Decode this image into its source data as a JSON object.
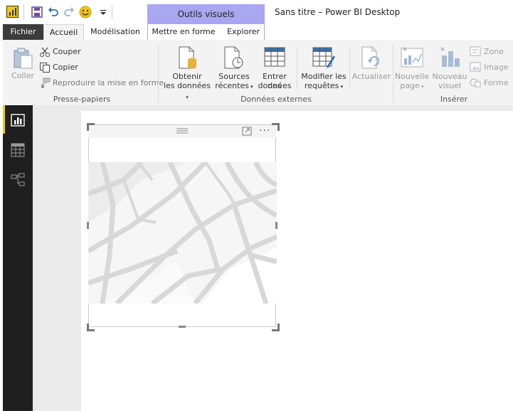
{
  "window": {
    "title": "Sans titre – Power BI Desktop",
    "contextual_tab_group": "Outils visuels"
  },
  "quick_access": {
    "icons": [
      "power-bi-icon",
      "save-icon",
      "undo-icon",
      "redo-icon",
      "smiley-icon",
      "customize-icon"
    ]
  },
  "tabs": {
    "fichier": "Fichier",
    "accueil": "Accueil",
    "modelisation": "Modélisation",
    "mettre_en_forme": "Mettre en forme",
    "explorer": "Explorer"
  },
  "ribbon": {
    "clipboard": {
      "coller": "Coller",
      "couper": "Couper",
      "copier": "Copier",
      "reproduire": "Reproduire la mise en forme",
      "group": "Presse-papiers"
    },
    "external_data": {
      "obtenir_1": "Obtenir",
      "obtenir_2": "les données",
      "sources_1": "Sources",
      "sources_2": "récentes",
      "entrer_1": "Entrer des",
      "entrer_2": "données",
      "modifier_1": "Modifier les",
      "modifier_2": "requêtes",
      "actualiser": "Actualiser",
      "group": "Données externes"
    },
    "insert": {
      "nouvelle_page_1": "Nouvelle",
      "nouvelle_page_2": "page",
      "nouveau_visuel_1": "Nouveau",
      "nouveau_visuel_2": "visuel",
      "zone": "Zone",
      "image": "Image",
      "forme": "Forme",
      "group": "Insérer"
    }
  },
  "left_nav": {
    "items": [
      "report-view-icon",
      "data-view-icon",
      "relationships-view-icon"
    ],
    "active": "report-view-icon"
  },
  "colors": {
    "accent": "#f2c811",
    "contextual_tab": "#a9a6f2",
    "nav_bg": "#1f1f1f",
    "file_tab": "#3c3c3c"
  }
}
